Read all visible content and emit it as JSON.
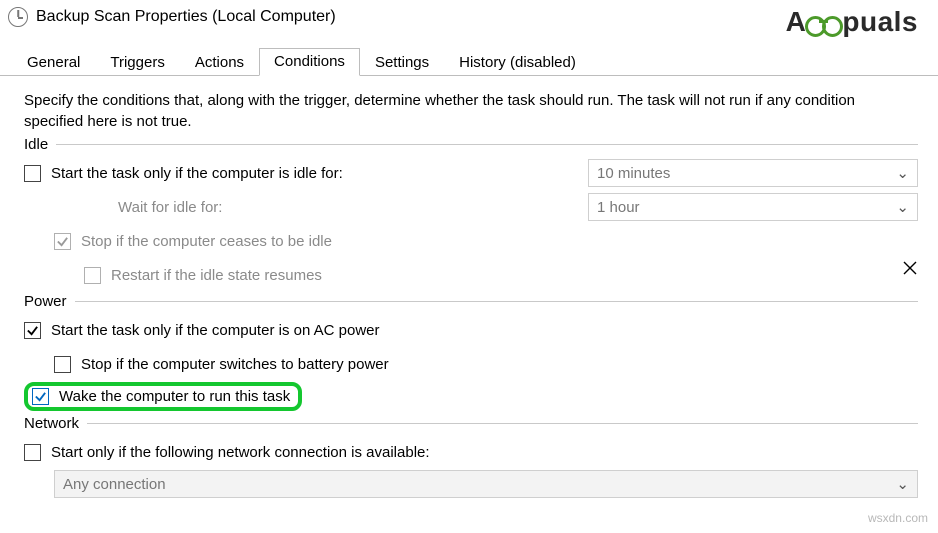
{
  "window": {
    "title": "Backup Scan Properties (Local Computer)"
  },
  "tabs": {
    "general": "General",
    "triggers": "Triggers",
    "actions": "Actions",
    "conditions": "Conditions",
    "settings": "Settings",
    "history": "History (disabled)"
  },
  "intro": "Specify the conditions that, along with the trigger, determine whether the task should run.  The task will not run  if any condition specified here is not true.",
  "idle": {
    "legend": "Idle",
    "start_if_idle": "Start the task only if the computer is idle for:",
    "wait_label": "Wait for idle for:",
    "stop_ceases": "Stop if the computer ceases to be idle",
    "restart_resumes": "Restart if the idle state resumes",
    "idle_for_value": "10 minutes",
    "wait_for_value": "1 hour"
  },
  "power": {
    "legend": "Power",
    "ac_power": "Start the task only if the computer is on AC power",
    "stop_battery": "Stop if the computer switches to battery power",
    "wake": "Wake the computer to run this task"
  },
  "network": {
    "legend": "Network",
    "start_if_conn": "Start only if the following network connection is available:",
    "conn_value": "Any connection"
  },
  "watermark": {
    "prefix": "A",
    "suffix": "puals"
  },
  "credit": "wsxdn.com"
}
